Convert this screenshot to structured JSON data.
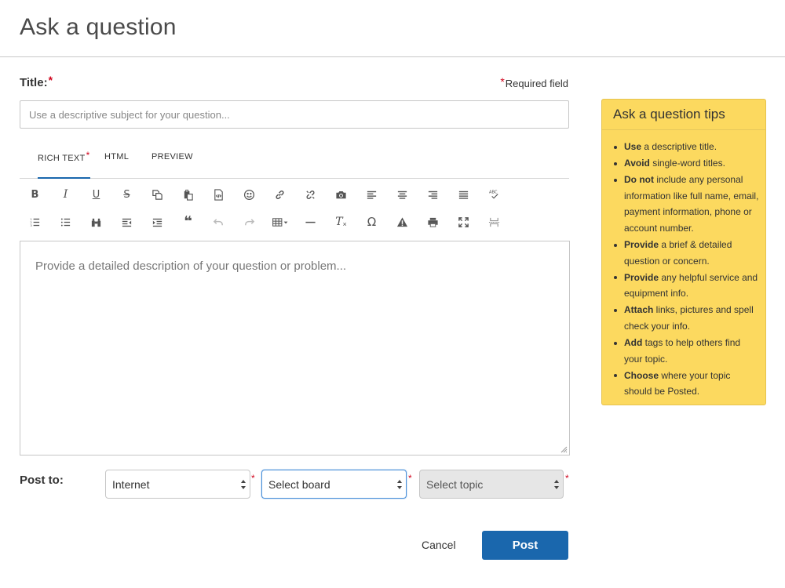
{
  "page": {
    "title": "Ask a question"
  },
  "form": {
    "title_label": "Title:",
    "required_mark": "*",
    "required_note": "Required field",
    "title_placeholder": "Use a descriptive subject for your question...",
    "body_placeholder": "Provide a detailed description of your question or problem...",
    "post_to_label": "Post to:"
  },
  "tabs": [
    {
      "label": "RICH TEXT",
      "active": true,
      "required": true
    },
    {
      "label": "HTML",
      "active": false
    },
    {
      "label": "PREVIEW",
      "active": false
    }
  ],
  "toolbar": {
    "row1": [
      "bold-icon",
      "italic-icon",
      "underline-icon",
      "strikethrough-icon",
      "copy-icon",
      "paste-icon",
      "source-code-icon",
      "emoji-icon",
      "link-icon",
      "unlink-icon",
      "camera-icon",
      "align-left-icon",
      "align-center-icon",
      "align-right-icon",
      "align-justify-icon",
      "spellcheck-icon"
    ],
    "row2": [
      "numbered-list-icon",
      "bulleted-list-icon",
      "find-icon",
      "outdent-icon",
      "indent-icon",
      "blockquote-icon",
      "undo-icon",
      "redo-icon",
      "table-icon",
      "horizontal-rule-icon",
      "clear-format-icon",
      "special-char-icon",
      "warning-icon",
      "print-icon",
      "fullscreen-icon",
      "page-break-icon"
    ],
    "glyphs": {
      "bold": "B",
      "italic": "I",
      "underline": "U",
      "strike": "S",
      "clear": "T",
      "omega": "Ω",
      "quote": "❝",
      "spell": "ABC"
    }
  },
  "selects": [
    {
      "value": "Internet",
      "required": true
    },
    {
      "value": "Select board",
      "required": true
    },
    {
      "value": "Select topic",
      "required": true
    }
  ],
  "actions": {
    "cancel_label": "Cancel",
    "post_label": "Post"
  },
  "tips": {
    "title": "Ask a question tips",
    "items": [
      {
        "bold": "Use",
        "rest": " a descriptive title."
      },
      {
        "bold": "Avoid",
        "rest": " single-word titles."
      },
      {
        "bold": "Do not",
        "rest": " include any personal information like full name, email, payment information, phone or account number."
      },
      {
        "bold": "Provide",
        "rest": " a brief & detailed question or concern."
      },
      {
        "bold": "Provide",
        "rest": " any helpful service and equipment info."
      },
      {
        "bold": "Attach",
        "rest": " links, pictures and spell check your info."
      },
      {
        "bold": "Add",
        "rest": " tags to help others find your topic."
      },
      {
        "bold": "Choose",
        "rest": " where your topic should be Posted."
      }
    ]
  },
  "colors": {
    "primary": "#1a67ad",
    "tips_bg": "#fcd95f",
    "required": "#d0021b"
  }
}
